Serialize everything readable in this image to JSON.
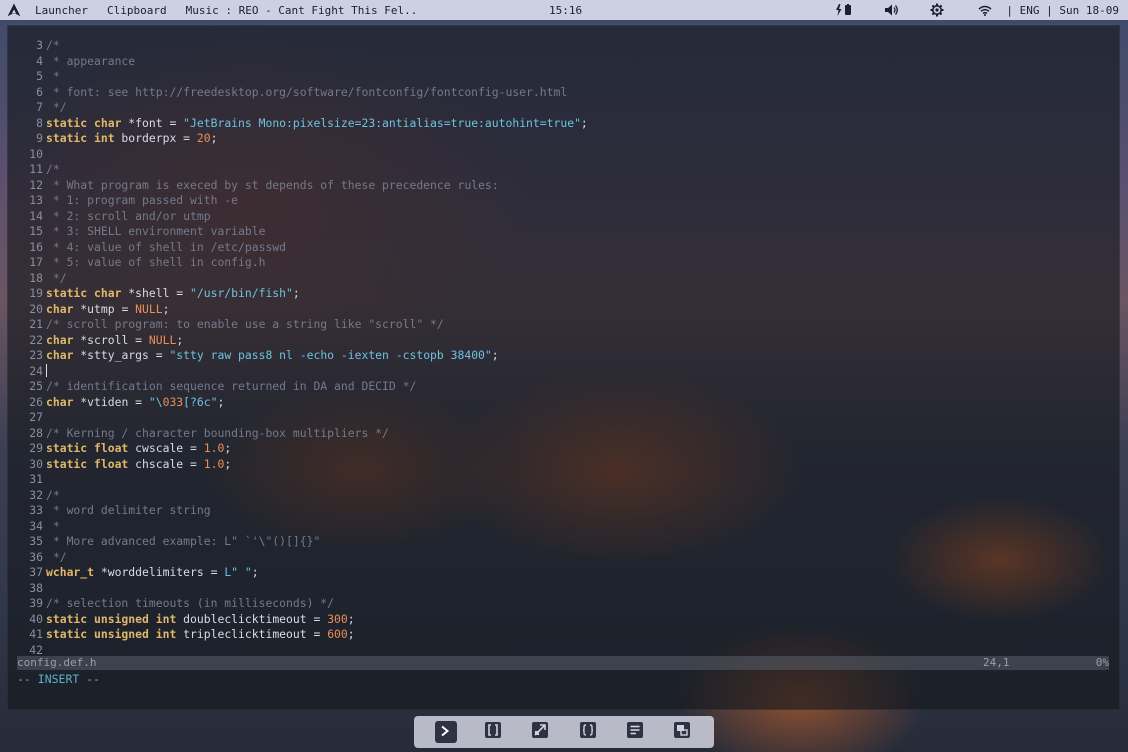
{
  "topbar": {
    "launcher": "Launcher",
    "clipboard": "Clipboard",
    "music": "Music : REO - Cant Fight This Fel..",
    "clock": "15:16",
    "lang": "| ENG | Sun 18-09",
    "icons": [
      "arch-logo-icon",
      "battery-charging-icon",
      "volume-icon",
      "settings-gear-icon",
      "wifi-icon"
    ]
  },
  "editor": {
    "lines": [
      {
        "n": "3",
        "t": [
          [
            "cm",
            "/*"
          ]
        ]
      },
      {
        "n": "4",
        "t": [
          [
            "cm",
            " * appearance"
          ]
        ]
      },
      {
        "n": "5",
        "t": [
          [
            "cm",
            " *"
          ]
        ]
      },
      {
        "n": "6",
        "t": [
          [
            "cm",
            " * font: see http://freedesktop.org/software/fontconfig/fontconfig-user.html"
          ]
        ]
      },
      {
        "n": "7",
        "t": [
          [
            "cm",
            " */"
          ]
        ]
      },
      {
        "n": "8",
        "t": [
          [
            "kw",
            "static char"
          ],
          [
            "tx",
            " *font = "
          ],
          [
            "st",
            "\"JetBrains Mono:pixelsize=23:antialias=true:autohint=true\""
          ],
          [
            "tx",
            ";"
          ]
        ]
      },
      {
        "n": "9",
        "t": [
          [
            "kw",
            "static int"
          ],
          [
            "tx",
            " borderpx = "
          ],
          [
            "nu",
            "20"
          ],
          [
            "tx",
            ";"
          ]
        ]
      },
      {
        "n": "10",
        "t": []
      },
      {
        "n": "11",
        "t": [
          [
            "cm",
            "/*"
          ]
        ]
      },
      {
        "n": "12",
        "t": [
          [
            "cm",
            " * What program is execed by st depends of these precedence rules:"
          ]
        ]
      },
      {
        "n": "13",
        "t": [
          [
            "cm",
            " * 1: program passed with -e"
          ]
        ]
      },
      {
        "n": "14",
        "t": [
          [
            "cm",
            " * 2: scroll and/or utmp"
          ]
        ]
      },
      {
        "n": "15",
        "t": [
          [
            "cm",
            " * 3: SHELL environment variable"
          ]
        ]
      },
      {
        "n": "16",
        "t": [
          [
            "cm",
            " * 4: value of shell in /etc/passwd"
          ]
        ]
      },
      {
        "n": "17",
        "t": [
          [
            "cm",
            " * 5: value of shell in config.h"
          ]
        ]
      },
      {
        "n": "18",
        "t": [
          [
            "cm",
            " */"
          ]
        ]
      },
      {
        "n": "19",
        "t": [
          [
            "kw",
            "static char"
          ],
          [
            "tx",
            " *shell = "
          ],
          [
            "st",
            "\"/usr/bin/fish\""
          ],
          [
            "tx",
            ";"
          ]
        ]
      },
      {
        "n": "20",
        "t": [
          [
            "kw",
            "char"
          ],
          [
            "tx",
            " *utmp = "
          ],
          [
            "nu",
            "NULL"
          ],
          [
            "tx",
            ";"
          ]
        ]
      },
      {
        "n": "21",
        "t": [
          [
            "cm",
            "/* scroll program: to enable use a string like \"scroll\" */"
          ]
        ]
      },
      {
        "n": "22",
        "t": [
          [
            "kw",
            "char"
          ],
          [
            "tx",
            " *scroll = "
          ],
          [
            "nu",
            "NULL"
          ],
          [
            "tx",
            ";"
          ]
        ]
      },
      {
        "n": "23",
        "t": [
          [
            "kw",
            "char"
          ],
          [
            "tx",
            " *stty_args = "
          ],
          [
            "st",
            "\"stty raw pass8 nl -echo -iexten -cstopb 38400\""
          ],
          [
            "tx",
            ";"
          ]
        ]
      },
      {
        "n": "24",
        "t": [],
        "cursor": true
      },
      {
        "n": "25",
        "t": [
          [
            "cm",
            "/* identification sequence returned in DA and DECID */"
          ]
        ]
      },
      {
        "n": "26",
        "t": [
          [
            "kw",
            "char"
          ],
          [
            "tx",
            " *vtiden = "
          ],
          [
            "st",
            "\"\\"
          ],
          [
            "nu",
            "033"
          ],
          [
            "st",
            "[?6c\""
          ],
          [
            "tx",
            ";"
          ]
        ]
      },
      {
        "n": "27",
        "t": []
      },
      {
        "n": "28",
        "t": [
          [
            "cm",
            "/* Kerning / character bounding-box multipliers */"
          ]
        ]
      },
      {
        "n": "29",
        "t": [
          [
            "kw",
            "static float"
          ],
          [
            "tx",
            " cwscale = "
          ],
          [
            "nu",
            "1.0"
          ],
          [
            "tx",
            ";"
          ]
        ]
      },
      {
        "n": "30",
        "t": [
          [
            "kw",
            "static float"
          ],
          [
            "tx",
            " chscale = "
          ],
          [
            "nu",
            "1.0"
          ],
          [
            "tx",
            ";"
          ]
        ]
      },
      {
        "n": "31",
        "t": []
      },
      {
        "n": "32",
        "t": [
          [
            "cm",
            "/*"
          ]
        ]
      },
      {
        "n": "33",
        "t": [
          [
            "cm",
            " * word delimiter string"
          ]
        ]
      },
      {
        "n": "34",
        "t": [
          [
            "cm",
            " *"
          ]
        ]
      },
      {
        "n": "35",
        "t": [
          [
            "cm",
            " * More advanced example: L\" `'\\\"()[]{}\""
          ]
        ]
      },
      {
        "n": "36",
        "t": [
          [
            "cm",
            " */"
          ]
        ]
      },
      {
        "n": "37",
        "t": [
          [
            "kw",
            "wchar_t"
          ],
          [
            "tx",
            " *worddelimiters = "
          ],
          [
            "st",
            "L\" \""
          ],
          [
            "tx",
            ";"
          ]
        ]
      },
      {
        "n": "38",
        "t": []
      },
      {
        "n": "39",
        "t": [
          [
            "cm",
            "/* selection timeouts (in milliseconds) */"
          ]
        ]
      },
      {
        "n": "40",
        "t": [
          [
            "kw",
            "static unsigned int"
          ],
          [
            "tx",
            " doubleclicktimeout = "
          ],
          [
            "nu",
            "300"
          ],
          [
            "tx",
            ";"
          ]
        ]
      },
      {
        "n": "41",
        "t": [
          [
            "kw",
            "static unsigned int"
          ],
          [
            "tx",
            " tripleclicktimeout = "
          ],
          [
            "nu",
            "600"
          ],
          [
            "tx",
            ";"
          ]
        ]
      },
      {
        "n": "42",
        "t": []
      }
    ],
    "status_file": "config.def.h",
    "status_pos": "24,1",
    "status_pct": "0%",
    "mode": "-- INSERT --"
  },
  "dock": {
    "items": [
      "terminal-icon",
      "brackets-icon",
      "screenshot-icon",
      "code-braces-icon",
      "notes-icon",
      "window-switch-icon"
    ],
    "active_index": 0
  }
}
